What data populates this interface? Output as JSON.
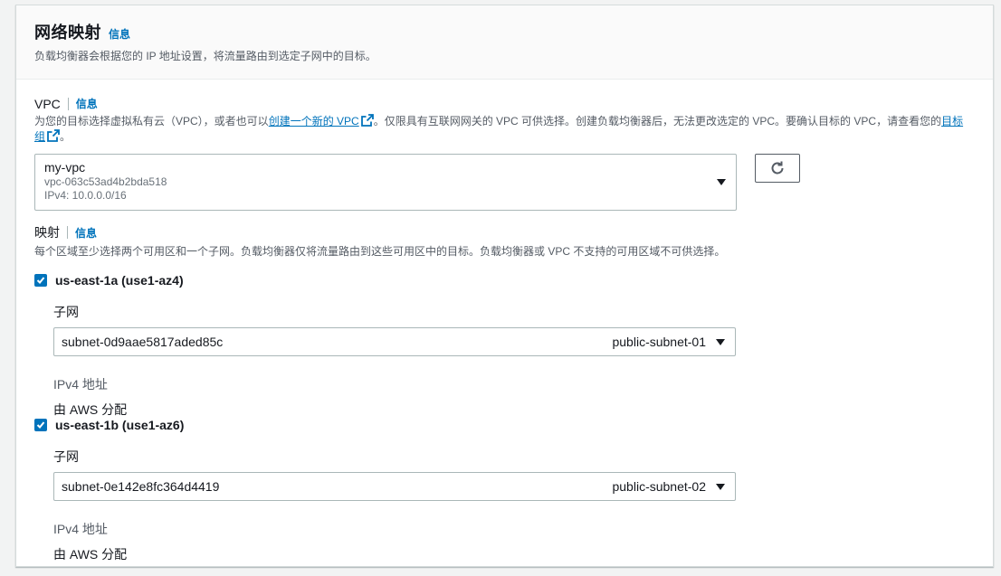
{
  "header": {
    "title": "网络映射",
    "info": "信息",
    "description": "负载均衡器会根据您的 IP 地址设置，将流量路由到选定子网中的目标。"
  },
  "vpc": {
    "label": "VPC",
    "info": "信息",
    "desc_part1": "为您的目标选择虚拟私有云（VPC），或者也可以",
    "desc_link1": "创建一个新的 VPC",
    "desc_part2": "。仅限具有互联网网关的 VPC 可供选择。创建负载均衡器后，无法更改选定的 VPC。要确认目标的 VPC，请查看您的",
    "desc_link2": "目标组",
    "desc_part3": "。",
    "selected": {
      "name": "my-vpc",
      "id": "vpc-063c53ad4b2bda518",
      "cidr": "IPv4: 10.0.0.0/16"
    }
  },
  "mapping": {
    "label": "映射",
    "info": "信息",
    "description": "每个区域至少选择两个可用区和一个子网。负载均衡器仅将流量路由到这些可用区中的目标。负载均衡器或 VPC 不支持的可用区域不可供选择。",
    "zones": [
      {
        "name": "us-east-1a (use1-az4)",
        "checked": true,
        "subnet_label": "子网",
        "subnet_id": "subnet-0d9aae5817aded85c",
        "subnet_name": "public-subnet-01",
        "ipv4_label": "IPv4 地址",
        "ipv4_value": "由 AWS 分配"
      },
      {
        "name": "us-east-1b (use1-az6)",
        "checked": true,
        "subnet_label": "子网",
        "subnet_id": "subnet-0e142e8fc364d4419",
        "subnet_name": "public-subnet-02",
        "ipv4_label": "IPv4 地址",
        "ipv4_value": "由 AWS 分配"
      }
    ]
  },
  "colors": {
    "accent": "#0073bb",
    "text": "#16191f",
    "muted": "#545b64"
  }
}
